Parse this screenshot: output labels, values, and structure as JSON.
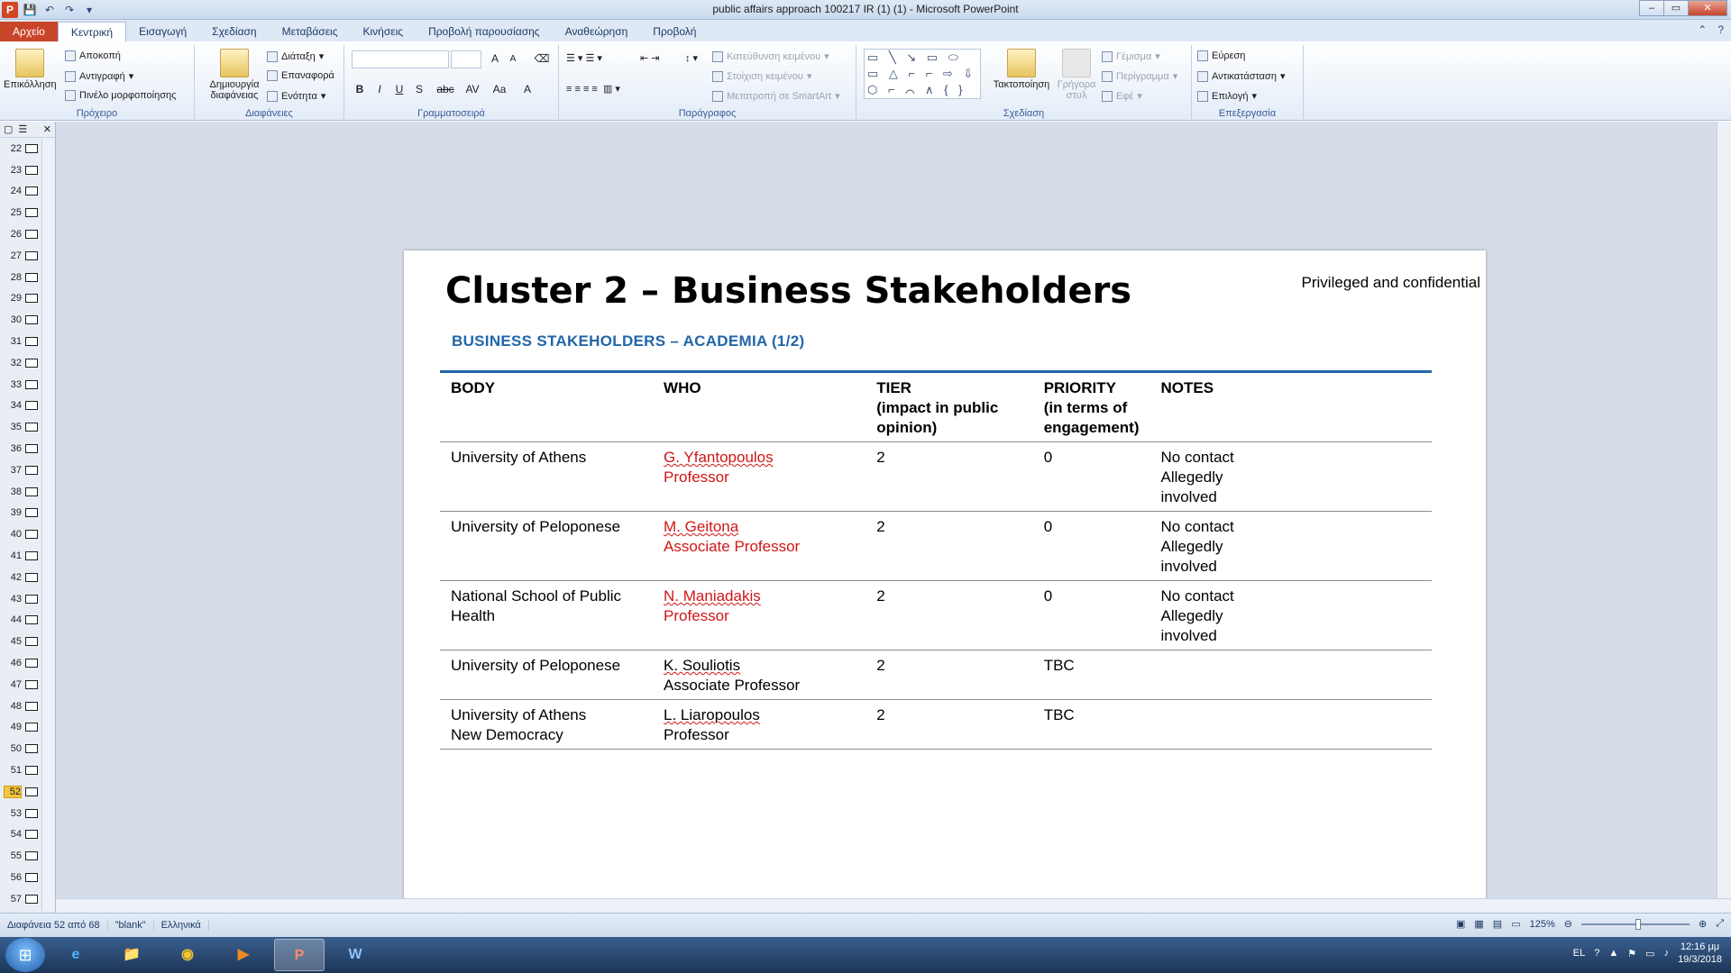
{
  "window": {
    "title": "public affairs approach 100217 IR (1) (1) - Microsoft PowerPoint",
    "minimize": "–",
    "maximize": "▭",
    "close": "✕"
  },
  "qat": {
    "app_icon": "P",
    "save": "💾",
    "undo": "↶",
    "redo": "↷",
    "customize": "▾"
  },
  "tabs": [
    "Αρχείο",
    "Κεντρική",
    "Εισαγωγή",
    "Σχεδίαση",
    "Μεταβάσεις",
    "Κινήσεις",
    "Προβολή παρουσίασης",
    "Αναθεώρηση",
    "Προβολή"
  ],
  "ribbon": {
    "clipboard": {
      "paste": "Επικόλληση",
      "cut": "Αποκοπή",
      "copy": "Αντιγραφή",
      "format_painter": "Πινέλο μορφοποίησης",
      "label": "Πρόχειρο"
    },
    "slides": {
      "new_slide_1": "Δημιουργία",
      "new_slide_2": "διαφάνειας",
      "layout": "Διάταξη",
      "reset": "Επαναφορά",
      "section": "Ενότητα",
      "label": "Διαφάνειες"
    },
    "font": {
      "label": "Γραμματοσειρά",
      "bold": "B",
      "italic": "I",
      "underline": "U",
      "shadow": "S",
      "strike": "abc",
      "spacing": "AV",
      "case": "Aa",
      "color": "A",
      "grow": "A",
      "shrink": "A"
    },
    "paragraph": {
      "label": "Παράγραφος",
      "text_direction": "Κατεύθυνση κειμένου",
      "align_text": "Στοίχιση κειμένου",
      "smartart": "Μετατροπή σε SmartArt"
    },
    "drawing": {
      "label": "Σχεδίαση",
      "arrange": "Τακτοποίηση",
      "quick_styles_1": "Γρήγορα",
      "quick_styles_2": "στυλ",
      "fill": "Γέμισμα",
      "outline": "Περίγραμμα",
      "effects": "Εφέ",
      "shapes": "▭ ╲ ↘ ▭ ⬭ ▭ △ ⌐ ⌐ ⇨ ⇩ ⬡ ⌐ ⌒ ∧ { } ☆"
    },
    "editing": {
      "label": "Επεξεργασία",
      "find": "Εύρεση",
      "replace": "Αντικατάσταση",
      "select": "Επιλογή"
    }
  },
  "slides_panel": {
    "items": [
      {
        "num": "22"
      },
      {
        "num": "23"
      },
      {
        "num": "24"
      },
      {
        "num": "25"
      },
      {
        "num": "26"
      },
      {
        "num": "27"
      },
      {
        "num": "28"
      },
      {
        "num": "29"
      },
      {
        "num": "30"
      },
      {
        "num": "31"
      },
      {
        "num": "32"
      },
      {
        "num": "33"
      },
      {
        "num": "34"
      },
      {
        "num": "35"
      },
      {
        "num": "36"
      },
      {
        "num": "37"
      },
      {
        "num": "38"
      },
      {
        "num": "39"
      },
      {
        "num": "40"
      },
      {
        "num": "41"
      },
      {
        "num": "42"
      },
      {
        "num": "43"
      },
      {
        "num": "44"
      },
      {
        "num": "45"
      },
      {
        "num": "46"
      },
      {
        "num": "47"
      },
      {
        "num": "48"
      },
      {
        "num": "49"
      },
      {
        "num": "50"
      },
      {
        "num": "51"
      },
      {
        "num": "52",
        "selected": true
      },
      {
        "num": "53"
      },
      {
        "num": "54"
      },
      {
        "num": "55"
      },
      {
        "num": "56"
      },
      {
        "num": "57"
      }
    ]
  },
  "slide": {
    "title": "Cluster 2 – Business Stakeholders",
    "confidential": "Privileged and confidential",
    "subtitle": "BUSINESS STAKEHOLDERS  – ACADEMIA (1/2)",
    "headers": {
      "body": "BODY",
      "who": "WHO",
      "tier_1": "TIER",
      "tier_2": "(impact in public opinion)",
      "priority_1": "PRIORITY",
      "priority_2": "(in terms of engagement)",
      "notes": "NOTES"
    },
    "rows": [
      {
        "body_1": "University of Athens",
        "body_2": "",
        "who_1": "G. Yfantopoulos",
        "who_2": "Professor",
        "red": true,
        "tier": "2",
        "priority": "0",
        "notes_1": "No contact",
        "notes_2": "Allegedly",
        "notes_3": "involved"
      },
      {
        "body_1": "University of Peloponese",
        "body_2": "",
        "who_1": "M. Geitona",
        "who_2": "Associate  Professor",
        "red": true,
        "tier": "2",
        "priority": "0",
        "notes_1": "No contact",
        "notes_2": "Allegedly",
        "notes_3": "involved"
      },
      {
        "body_1": "National School of Public Health",
        "body_2": "",
        "who_1": "N. Maniadakis",
        "who_2": "Professor",
        "red": true,
        "tier": "2",
        "priority": "0",
        "notes_1": "No contact",
        "notes_2": "Allegedly",
        "notes_3": "involved"
      },
      {
        "body_1": "University of Peloponese",
        "body_2": "",
        "who_1": "K. Souliotis",
        "who_2": "Associate  Professor",
        "red": false,
        "tier": "2",
        "priority": "TBC",
        "notes_1": "",
        "notes_2": "",
        "notes_3": ""
      },
      {
        "body_1": "University of Athens",
        "body_2": "New Democracy",
        "who_1": "L. Liaropoulos",
        "who_2": "Professor",
        "red": false,
        "tier": "2",
        "priority": "TBC",
        "notes_1": "",
        "notes_2": "",
        "notes_3": ""
      }
    ]
  },
  "status": {
    "slide_info": "Διαφάνεια 52 από 68",
    "theme": "\"blank\"",
    "language": "Ελληνικά",
    "zoom": "125%"
  },
  "taskbar": {
    "start": "⊞",
    "apps": [
      "e",
      "📁",
      "◉",
      "▶",
      "P",
      "W"
    ],
    "lang": "EL",
    "time": "12:16 μμ",
    "date": "19/3/2018"
  },
  "colors": {
    "accent_blue": "#2266a8",
    "red_text": "#d01616",
    "file_tab": "#c9452a"
  }
}
